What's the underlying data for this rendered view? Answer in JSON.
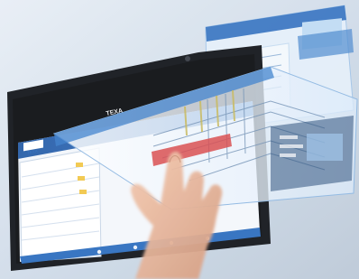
{
  "brand": {
    "logo_text": "TEXA",
    "bezel_text": "TEXA"
  },
  "app": {
    "left_panel_labels": [
      "",
      "",
      "",
      "",
      "",
      "",
      "",
      ""
    ],
    "diagram_labels": [
      "",
      "",
      ""
    ]
  },
  "colors": {
    "frame_bg": "#cfd9e6",
    "tablet_body": "#15181d",
    "screen_blue": "#2f6fbf",
    "overlay_tint": "#dff0ff",
    "alert_red": "#d8484a",
    "skin": "#e8b49a"
  },
  "icons": [
    "home-icon",
    "search-icon",
    "settings-icon",
    "back-icon"
  ]
}
